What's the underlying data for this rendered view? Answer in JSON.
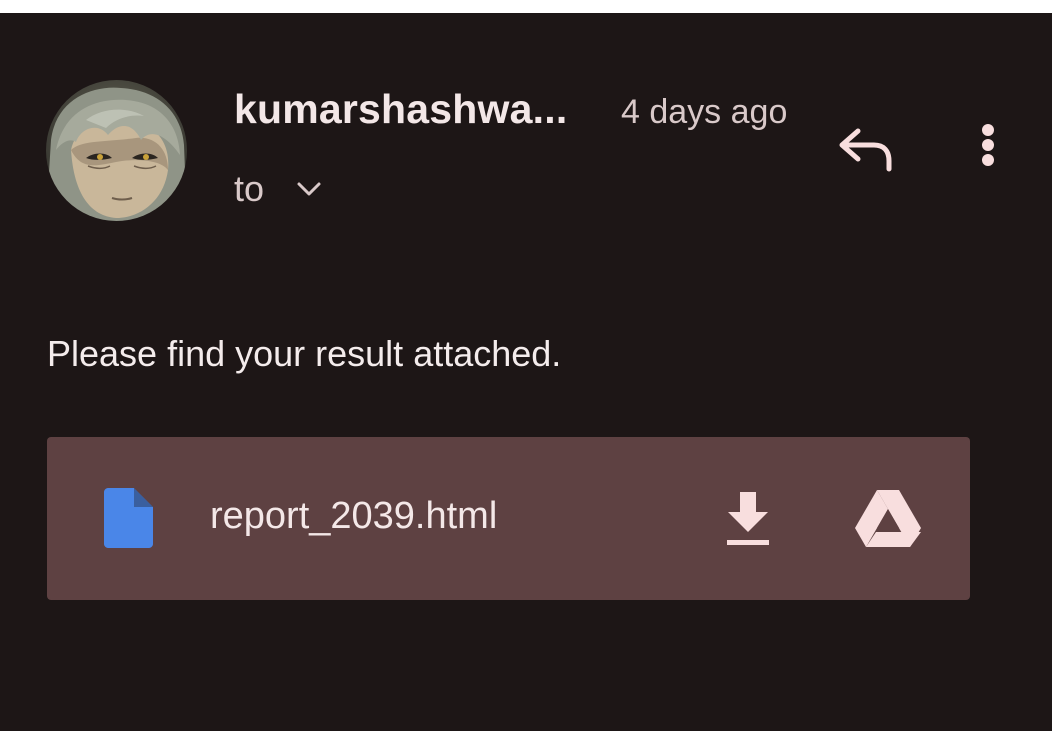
{
  "message": {
    "sender_name": "kumarshashwa...",
    "time_ago": "4 days ago",
    "to_label": "to",
    "body": "Please find your result attached."
  },
  "actions": {
    "reply_icon": "reply-icon",
    "more_icon": "more-vert-icon",
    "expand_icon": "chevron-down-icon"
  },
  "attachment": {
    "file_name": "report_2039.html",
    "file_icon": "document-icon",
    "download_icon": "download-icon",
    "drive_icon": "google-drive-icon"
  },
  "colors": {
    "background": "#1d1616",
    "attachment_background": "#5e4142",
    "file_icon": "#4a86e8",
    "text": "#f2e6e6",
    "icon_tint": "#f8dede"
  }
}
